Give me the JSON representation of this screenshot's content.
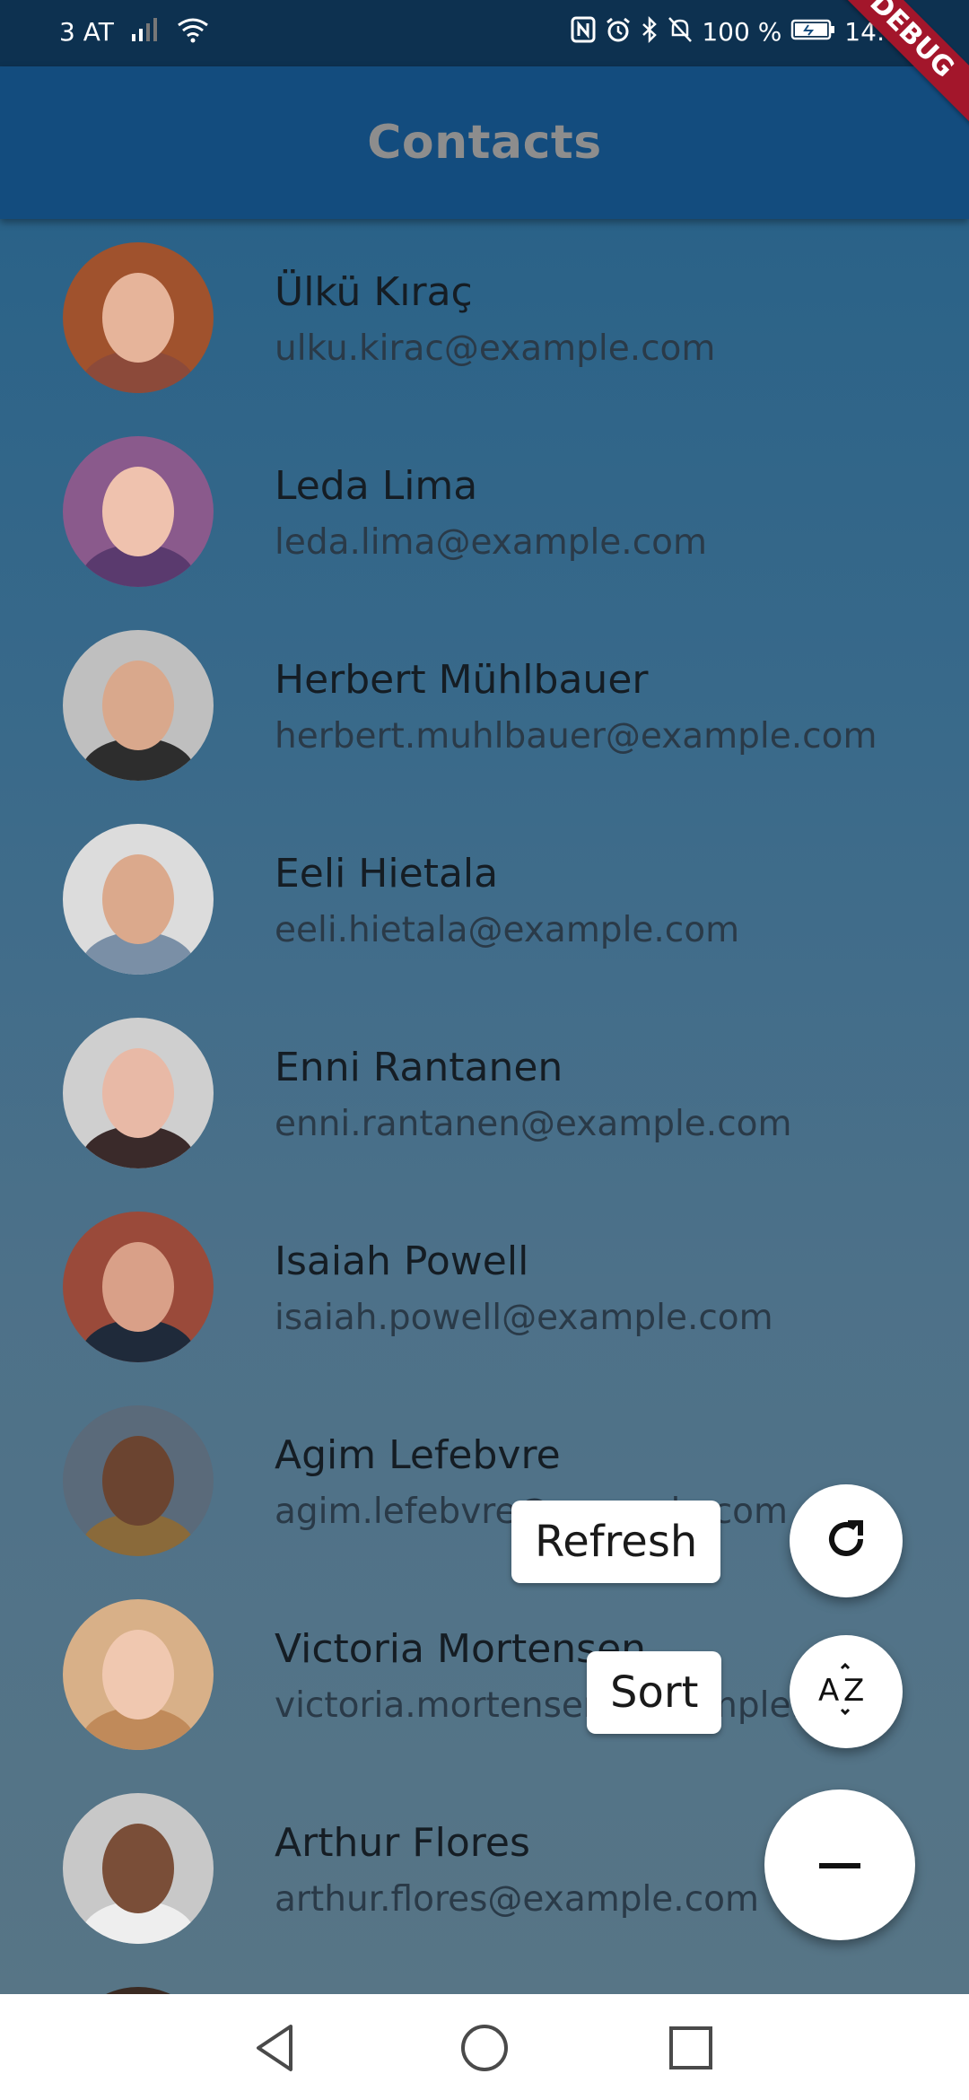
{
  "status_bar": {
    "carrier": "3 AT",
    "battery": "100 %",
    "time": "14:16",
    "icons": [
      "signal-icon",
      "wifi-icon",
      "nfc-icon",
      "alarm-icon",
      "bluetooth-icon",
      "mute-icon",
      "battery-icon"
    ]
  },
  "debug_banner": "DEBUG",
  "app_bar": {
    "title": "Contacts"
  },
  "contacts": [
    {
      "name": "Ülkü Kıraç",
      "email": "ulku.kirac@example.com",
      "skin": "#e6b49a",
      "shirt": "#8c4a3a",
      "bg": "#a0522d"
    },
    {
      "name": "Leda Lima",
      "email": "leda.lima@example.com",
      "skin": "#efc2ae",
      "shirt": "#5a3a6e",
      "bg": "#8a5a8c"
    },
    {
      "name": "Herbert Mühlbauer",
      "email": "herbert.muhlbauer@example.com",
      "skin": "#d9a88c",
      "shirt": "#2d2d2d",
      "bg": "#bfbfbf"
    },
    {
      "name": "Eeli Hietala",
      "email": "eeli.hietala@example.com",
      "skin": "#dba98c",
      "shirt": "#7a8fa6",
      "bg": "#dcdcdc"
    },
    {
      "name": "Enni Rantanen",
      "email": "enni.rantanen@example.com",
      "skin": "#e8b9a6",
      "shirt": "#3a2a2a",
      "bg": "#cfcfcf"
    },
    {
      "name": "Isaiah Powell",
      "email": "isaiah.powell@example.com",
      "skin": "#d9a088",
      "shirt": "#1f2a3a",
      "bg": "#9a4a3a"
    },
    {
      "name": "Agim Lefebvre",
      "email": "agim.lefebvre@example.com",
      "skin": "#6b4430",
      "shirt": "#8a6a3a",
      "bg": "#5a6a7a"
    },
    {
      "name": "Victoria Mortensen",
      "email": "victoria.mortensen@example.com",
      "skin": "#f0c8b0",
      "shirt": "#c08a5a",
      "bg": "#d8b088"
    },
    {
      "name": "Arthur Flores",
      "email": "arthur.flores@example.com",
      "skin": "#7a4e38",
      "shirt": "#eeeeee",
      "bg": "#c8c8c8"
    }
  ],
  "speed_dial": {
    "refresh_label": "Refresh",
    "sort_label": "Sort",
    "refresh_icon": "refresh-icon",
    "sort_icon": "sort-az-icon",
    "close_icon": "minus-icon"
  },
  "nav_bar": {
    "icons": [
      "back-icon",
      "home-icon",
      "recents-icon"
    ]
  }
}
